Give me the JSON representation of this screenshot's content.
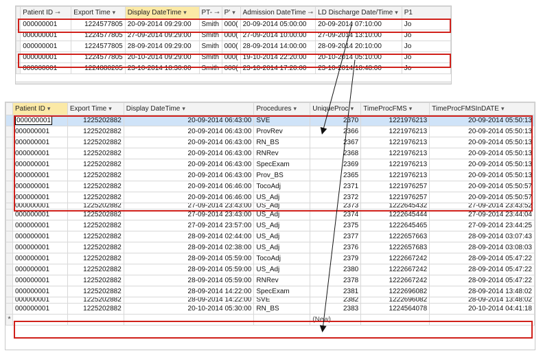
{
  "top_table": {
    "columns": [
      {
        "label": "Patient ID",
        "sort": "⊸",
        "highlight": false
      },
      {
        "label": "Export Time",
        "sort": "▾",
        "highlight": false
      },
      {
        "label": "Display DateTime",
        "sort": "▾",
        "highlight": true
      },
      {
        "label": "PT-",
        "sort": "⊸",
        "highlight": false
      },
      {
        "label": "P'",
        "sort": "▾",
        "highlight": false
      },
      {
        "label": "Admission DateTime",
        "sort": "⊸",
        "highlight": false
      },
      {
        "label": "LD Discharge Date/Time",
        "sort": "▾",
        "highlight": false
      },
      {
        "label": "P1",
        "sort": "",
        "highlight": false
      }
    ],
    "rows": [
      [
        "000000001",
        "1224577805",
        "20-09-2014 09:29:00",
        "Smith",
        "000(",
        "20-09-2014 05:00:00",
        "20-09-2014 07:10:00",
        "Jo"
      ],
      [
        "000000001",
        "1224577805",
        "27-09-2014 09:29:00",
        "Smith",
        "000(",
        "27-09-2014 10:00:00",
        "27-09-2014 13:10:00",
        "Jo"
      ],
      [
        "000000001",
        "1224577805",
        "28-09-2014 09:29:00",
        "Smith",
        "000(",
        "28-09-2014 14:00:00",
        "28-09-2014 20:10:00",
        "Jo"
      ],
      [
        "000000001",
        "1224577805",
        "20-10-2014 09:29:00",
        "Smith",
        "000(",
        "19-10-2014 22:20:00",
        "20-10-2014 05:10:00",
        "Jo"
      ],
      [
        "000000001",
        "1224880205",
        "23-10-2014 18:30:00",
        "Smith",
        "000(",
        "23-10-2014 17:20:00",
        "23-10-2014 18:48:00",
        "Jo"
      ]
    ]
  },
  "bottom_table": {
    "columns": [
      {
        "label": "Patient ID",
        "sort": "▾",
        "highlight": true
      },
      {
        "label": "Export Time",
        "sort": "▾",
        "highlight": false
      },
      {
        "label": "Display DateTime",
        "sort": "▾",
        "highlight": false
      },
      {
        "label": "Procedures",
        "sort": "▾",
        "highlight": false
      },
      {
        "label": "UniqueProc",
        "sort": "▾",
        "highlight": false
      },
      {
        "label": "TimeProcFMS",
        "sort": "▾",
        "highlight": false
      },
      {
        "label": "TimeProcFMSInDATE",
        "sort": "▾",
        "highlight": false
      }
    ],
    "rows": [
      [
        "000000001",
        "1225202882",
        "20-09-2014 06:43:00",
        "SVE",
        "2370",
        "1221976213",
        "20-09-2014 05:50:13"
      ],
      [
        "000000001",
        "1225202882",
        "20-09-2014 06:43:00",
        "ProvRev",
        "2366",
        "1221976213",
        "20-09-2014 05:50:13"
      ],
      [
        "000000001",
        "1225202882",
        "20-09-2014 06:43:00",
        "RN_BS",
        "2367",
        "1221976213",
        "20-09-2014 05:50:13"
      ],
      [
        "000000001",
        "1225202882",
        "20-09-2014 06:43:00",
        "RNRev",
        "2368",
        "1221976213",
        "20-09-2014 05:50:13"
      ],
      [
        "000000001",
        "1225202882",
        "20-09-2014 06:43:00",
        "SpecExam",
        "2369",
        "1221976213",
        "20-09-2014 05:50:13"
      ],
      [
        "000000001",
        "1225202882",
        "20-09-2014 06:43:00",
        "Prov_BS",
        "2365",
        "1221976213",
        "20-09-2014 05:50:13"
      ],
      [
        "000000001",
        "1225202882",
        "20-09-2014 06:46:00",
        "TocoAdj",
        "2371",
        "1221976257",
        "20-09-2014 05:50:57"
      ],
      [
        "000000001",
        "1225202882",
        "20-09-2014 06:46:00",
        "US_Adj",
        "2372",
        "1221976257",
        "20-09-2014 05:50:57"
      ],
      [
        "000000001",
        "1225202882",
        "27-09-2014 23:43:00",
        "US_Adj",
        "2373",
        "1222645432",
        "27-09-2014 23:43:52"
      ],
      [
        "000000001",
        "1225202882",
        "27-09-2014 23:43:00",
        "US_Adj",
        "2374",
        "1222645444",
        "27-09-2014 23:44:04"
      ],
      [
        "000000001",
        "1225202882",
        "27-09-2014 23:57:00",
        "US_Adj",
        "2375",
        "1222645465",
        "27-09-2014 23:44:25"
      ],
      [
        "000000001",
        "1225202882",
        "28-09-2014 02:44:00",
        "US_Adj",
        "2377",
        "1222657663",
        "28-09-2014 03:07:43"
      ],
      [
        "000000001",
        "1225202882",
        "28-09-2014 02:38:00",
        "US_Adj",
        "2376",
        "1222657683",
        "28-09-2014 03:08:03"
      ],
      [
        "000000001",
        "1225202882",
        "28-09-2014 05:59:00",
        "TocoAdj",
        "2379",
        "1222667242",
        "28-09-2014 05:47:22"
      ],
      [
        "000000001",
        "1225202882",
        "28-09-2014 05:59:00",
        "US_Adj",
        "2380",
        "1222667242",
        "28-09-2014 05:47:22"
      ],
      [
        "000000001",
        "1225202882",
        "28-09-2014 05:59:00",
        "RNRev",
        "2378",
        "1222667242",
        "28-09-2014 05:47:22"
      ],
      [
        "000000001",
        "1225202882",
        "28-09-2014 14:22:00",
        "SpecExam",
        "2381",
        "1222696082",
        "28-09-2014 13:48:02"
      ],
      [
        "000000001",
        "1225202882",
        "28-09-2014 14:22:00",
        "SVE",
        "2382",
        "1222696082",
        "28-09-2014 13:48:02"
      ],
      [
        "000000001",
        "1225202882",
        "20-10-2014 05:30:00",
        "RN_BS",
        "2383",
        "1224564078",
        "20-10-2014 04:41:18"
      ]
    ],
    "new_row_marker": "*",
    "new_row_label": "(New)"
  },
  "colors": {
    "highlight_box": "#d0201a",
    "header_highlight": "#fbe9a6",
    "selected_row": "#cfe3f8"
  }
}
